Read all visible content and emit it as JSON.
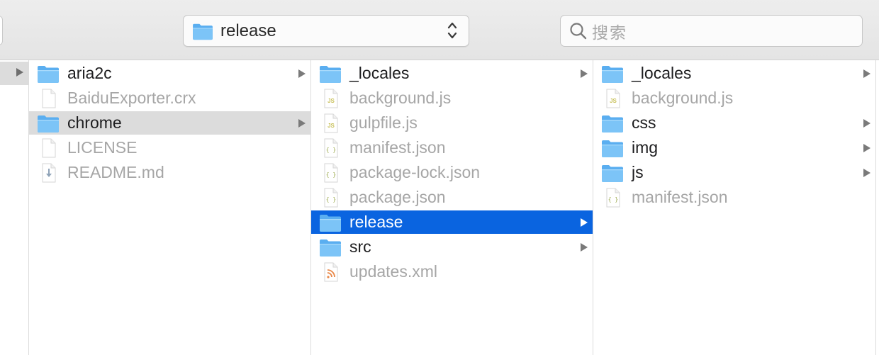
{
  "toolbar": {
    "path_popup_label": "release",
    "search_placeholder": "搜索"
  },
  "colors": {
    "folder": "#64b7f2",
    "selection_active": "#0a64e0",
    "selection_inactive": "#dcdcdc"
  },
  "columns": {
    "col1": [
      {
        "name": "aria2c",
        "kind": "folder",
        "has_children": true
      },
      {
        "name": "BaiduExporter.crx",
        "kind": "doc-icon"
      },
      {
        "name": "chrome",
        "kind": "folder",
        "has_children": true,
        "selected": "inactive"
      },
      {
        "name": "LICENSE",
        "kind": "doc-icon"
      },
      {
        "name": "README.md",
        "kind": "markdown-icon"
      }
    ],
    "col2": [
      {
        "name": "_locales",
        "kind": "folder",
        "has_children": true
      },
      {
        "name": "background.js",
        "kind": "js-icon"
      },
      {
        "name": "gulpfile.js",
        "kind": "js-icon"
      },
      {
        "name": "manifest.json",
        "kind": "json-icon"
      },
      {
        "name": "package-lock.json",
        "kind": "json-icon"
      },
      {
        "name": "package.json",
        "kind": "json-icon"
      },
      {
        "name": "release",
        "kind": "folder",
        "has_children": true,
        "selected": "active"
      },
      {
        "name": "src",
        "kind": "folder",
        "has_children": true
      },
      {
        "name": "updates.xml",
        "kind": "rss-icon"
      }
    ],
    "col3": [
      {
        "name": "_locales",
        "kind": "folder",
        "has_children": true
      },
      {
        "name": "background.js",
        "kind": "js-icon"
      },
      {
        "name": "css",
        "kind": "folder",
        "has_children": true
      },
      {
        "name": "img",
        "kind": "folder",
        "has_children": true
      },
      {
        "name": "js",
        "kind": "folder",
        "has_children": true
      },
      {
        "name": "manifest.json",
        "kind": "json-icon"
      }
    ]
  }
}
